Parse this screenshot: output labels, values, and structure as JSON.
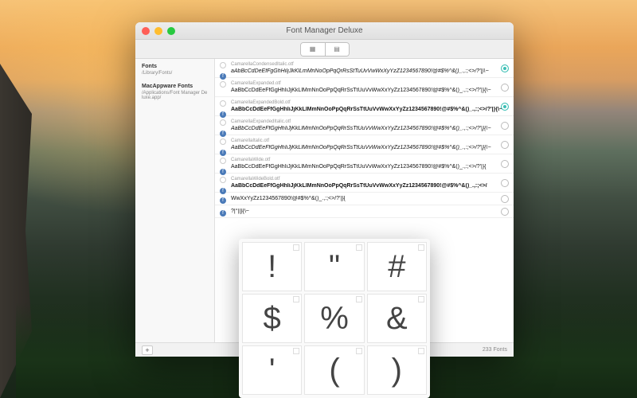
{
  "window": {
    "title": "Font Manager Deluxe"
  },
  "toolbar": {
    "view_list": "▦",
    "view_grid": "▤"
  },
  "sidebar": {
    "groups": [
      {
        "title": "Fonts",
        "path": "/Library/Fonts/"
      },
      {
        "title": "MacAppware Fonts",
        "path": "/Applications/Font Manager Deluxe.app/"
      }
    ]
  },
  "fonts": [
    {
      "name": "CamarellaCondensedItalic.otf",
      "sample": "aAbBcCdDeEfFgGhHiIjJkKlLmMnNoOpPqQrRsStTuUvVwWxXyYzZ1234567890!@#$%^&()_.,:;<>/?′|}\\~",
      "badge": "f",
      "radio": "teal",
      "bold": false,
      "italic": true
    },
    {
      "name": "CamarellaExpanded.otf",
      "sample": "AaBbCcDdEeFfGgHhIiJjKkLlMmNnOoPpQqRrSsTtUuVvWwXxYyZz1234567890!@#$%^&()_.,:;<>/?'|}{\\~",
      "badge": "",
      "radio": "",
      "bold": false,
      "italic": false
    },
    {
      "name": "CamarellaExpandedBold.otf",
      "sample": "AaBbCcDdEeFfGgHhIiJjKkLlMmNnOoPpQqRrSsTtUuVvWwXxYyZz1234567890!@#$%^&()_.,:;<>/?'|}{\\~",
      "badge": "f",
      "radio": "teal",
      "bold": true,
      "italic": false
    },
    {
      "name": "CamarellaExpandedItalic.otf",
      "sample": "AaBbCcDdEeFfGgHhIiJjKkLlMmNnOoPpQqRrSsTtUuVvWwXxYyZz1234567890!@#$%^&()_.,:;<>/?'|}{\\~",
      "badge": "f",
      "radio": "",
      "bold": false,
      "italic": true
    },
    {
      "name": "CamarellaItalic.otf",
      "sample": "AaBbCcDdEeFfGgHhIiJjKkLlMmNnOoPpQqRrSsTtUuVvWwXxYyZz1234567890!@#$%^&()_.,:;<>/?'|}{\\~",
      "badge": "f",
      "radio": "",
      "bold": false,
      "italic": true
    },
    {
      "name": "CamarellaWide.otf",
      "sample": "AaBbCcDdEeFfGgHhIiJjKkLlMmNnOoPpQqRrSsTtUuVvWwXxYyZz1234567890!@#$%^&()_.,:;<>/?'|}{",
      "badge": "f",
      "radio": "",
      "bold": false,
      "italic": false
    },
    {
      "name": "CamarellaWideBold.otf",
      "sample": "AaBbCcDdEeFfGgHhIiJjKkLlMmNnOoPpQqRrSsTtUuVvWwXxYyZz1234567890!@#$%^&()_.,:;<>/",
      "badge": "f",
      "radio": "",
      "bold": true,
      "italic": false
    },
    {
      "name": "",
      "sample": "WwXxYyZz1234567890!@#$%^&()_.,:;<>/?'|}{",
      "badge": "f",
      "radio": "",
      "bold": false,
      "italic": false
    },
    {
      "name": "",
      "sample": "?|°||}{\\~",
      "badge": "f",
      "radio": "",
      "bold": false,
      "italic": false
    }
  ],
  "footer": {
    "add": "+",
    "count": "233 Fonts"
  },
  "char_panel": {
    "chars": [
      "!",
      "\"",
      "#",
      "$",
      "%",
      "&",
      "'",
      "(",
      ")"
    ]
  }
}
